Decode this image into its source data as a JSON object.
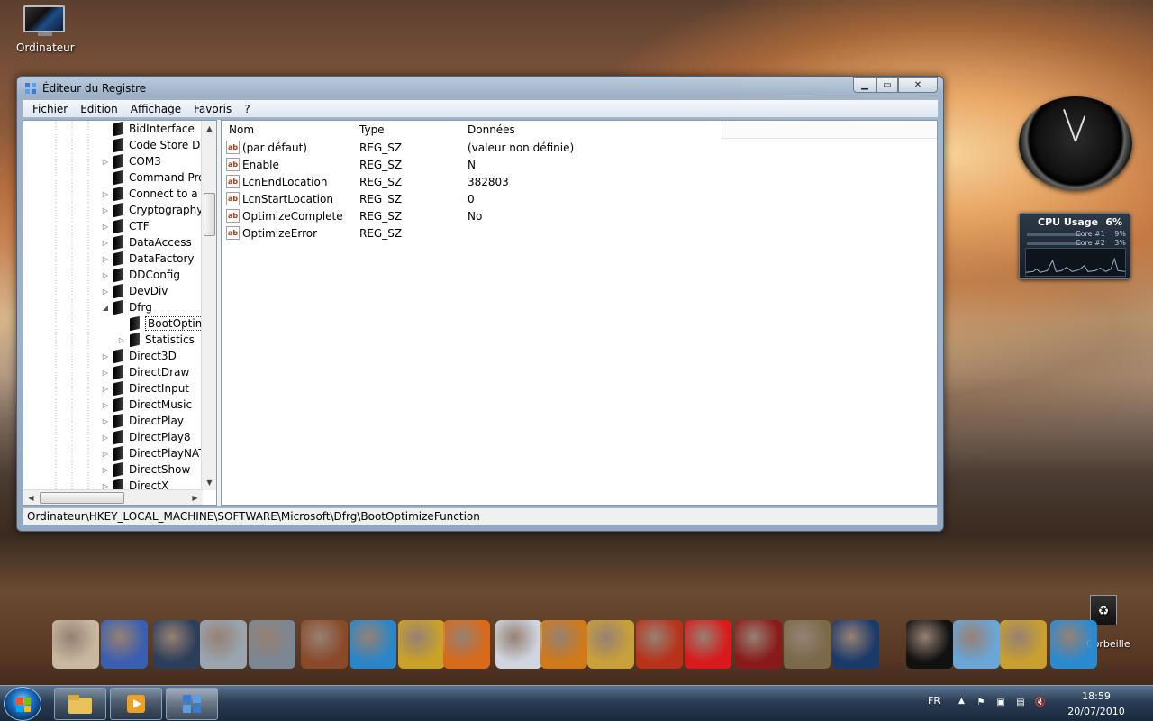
{
  "desktop": {
    "computer_icon_label": "Ordinateur",
    "recycle_label": "Corbeille"
  },
  "window": {
    "title": "Éditeur du Registre",
    "controls": {
      "minimize": "▁",
      "maximize": "▭",
      "close": "✕"
    },
    "menu": [
      "Fichier",
      "Edition",
      "Affichage",
      "Favoris",
      "?"
    ],
    "tree": [
      {
        "label": "BidInterface",
        "expander": ""
      },
      {
        "label": "Code Store Da",
        "expander": ""
      },
      {
        "label": "COM3",
        "expander": "▷"
      },
      {
        "label": "Command Pro",
        "expander": ""
      },
      {
        "label": "Connect to a N",
        "expander": "▷"
      },
      {
        "label": "Cryptography",
        "expander": "▷"
      },
      {
        "label": "CTF",
        "expander": "▷"
      },
      {
        "label": "DataAccess",
        "expander": "▷"
      },
      {
        "label": "DataFactory",
        "expander": "▷"
      },
      {
        "label": "DDConfig",
        "expander": "▷"
      },
      {
        "label": "DevDiv",
        "expander": "▷"
      },
      {
        "label": "Dfrg",
        "expander": "◢"
      },
      {
        "label": "BootOptim",
        "expander": "",
        "child": true,
        "selected": true
      },
      {
        "label": "Statistics",
        "expander": "▷",
        "child": true
      },
      {
        "label": "Direct3D",
        "expander": "▷"
      },
      {
        "label": "DirectDraw",
        "expander": "▷"
      },
      {
        "label": "DirectInput",
        "expander": "▷"
      },
      {
        "label": "DirectMusic",
        "expander": "▷"
      },
      {
        "label": "DirectPlay",
        "expander": "▷"
      },
      {
        "label": "DirectPlay8",
        "expander": "▷"
      },
      {
        "label": "DirectPlayNAT",
        "expander": "▷"
      },
      {
        "label": "DirectShow",
        "expander": "▷"
      },
      {
        "label": "DirectX",
        "expander": "▷"
      }
    ],
    "list": {
      "headers": [
        "Nom",
        "Type",
        "Données"
      ],
      "rows": [
        {
          "name": "(par défaut)",
          "type": "REG_SZ",
          "data": "(valeur non définie)"
        },
        {
          "name": "Enable",
          "type": "REG_SZ",
          "data": "N"
        },
        {
          "name": "LcnEndLocation",
          "type": "REG_SZ",
          "data": "382803"
        },
        {
          "name": "LcnStartLocation",
          "type": "REG_SZ",
          "data": "0"
        },
        {
          "name": "OptimizeComplete",
          "type": "REG_SZ",
          "data": "No"
        },
        {
          "name": "OptimizeError",
          "type": "REG_SZ",
          "data": ""
        }
      ]
    },
    "status_path": "Ordinateur\\HKEY_LOCAL_MACHINE\\SOFTWARE\\Microsoft\\Dfrg\\BootOptimizeFunction"
  },
  "cpu_gadget": {
    "title": "CPU Usage",
    "percent": "6%",
    "cores": [
      {
        "label": "Core #1",
        "value": "9%"
      },
      {
        "label": "Core #2",
        "value": "3%"
      }
    ]
  },
  "dock": [
    {
      "name": "cat-icon",
      "color": "#c8b8a0"
    },
    {
      "name": "blue-cube-icon",
      "color": "#3b5fb0"
    },
    {
      "name": "media-player-icon",
      "color": "#2c3e5a"
    },
    {
      "name": "shield-icon",
      "color": "#9aa5b0"
    },
    {
      "name": "camera-icon",
      "color": "#7b8794"
    },
    {
      "name": "emule-icon",
      "color": "#8a4a2a"
    },
    {
      "name": "messenger-icon",
      "color": "#2a86c8"
    },
    {
      "name": "k-app-icon",
      "color": "#caa22a"
    },
    {
      "name": "firefox-icon",
      "color": "#d86a1a"
    },
    {
      "name": "rocket-icon",
      "color": "#cfd6e0"
    },
    {
      "name": "radiation-icon",
      "color": "#d07a1a"
    },
    {
      "name": "photoshop-icon",
      "color": "#c9a03a"
    },
    {
      "name": "eye-icon",
      "color": "#b8321a"
    },
    {
      "name": "avira-icon",
      "color": "#d91a1a"
    },
    {
      "name": "ccleaner-icon",
      "color": "#8a1a1a"
    },
    {
      "name": "bitcomet-icon",
      "color": "#7a6a4a"
    },
    {
      "name": "r-app-icon",
      "color": "#1a3a6a"
    },
    {
      "name": "mt-icon",
      "color": "#111111"
    },
    {
      "name": "scanner-icon",
      "color": "#6aa6d6"
    },
    {
      "name": "tools-icon",
      "color": "#c9a030"
    },
    {
      "name": "trash-icon",
      "color": "#2a8ad0"
    }
  ],
  "taskbar": {
    "language": "FR",
    "time": "18:59",
    "date": "20/07/2010"
  }
}
